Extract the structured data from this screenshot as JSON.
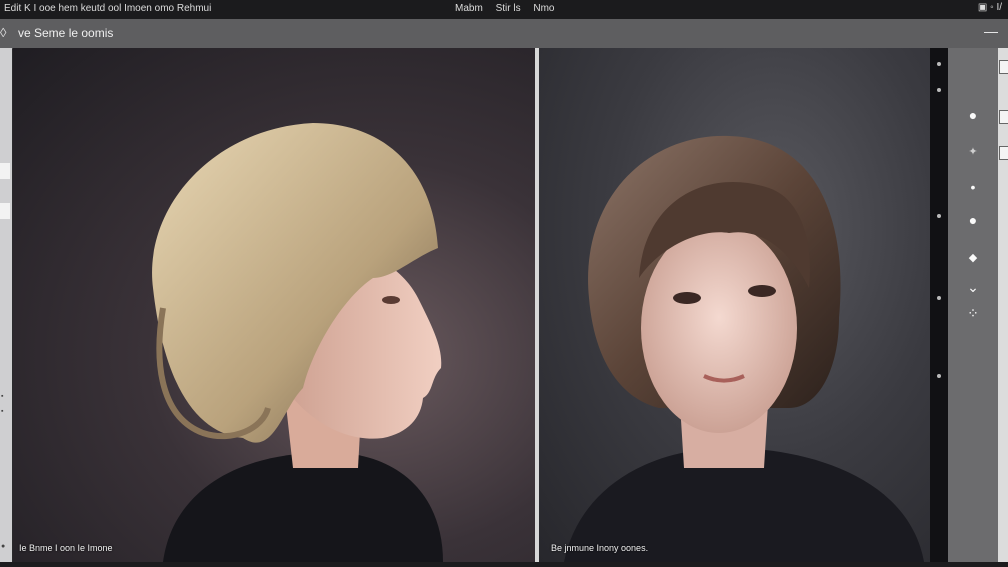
{
  "menubar": {
    "left_text": "Edit K  I  ooe  hem  keutd  ool  Imoen omo  Rehmui",
    "center_items": [
      "Mabm",
      "Stir  ls",
      "Nmo"
    ],
    "right_text": "▣  ◦  I/"
  },
  "toolbar": {
    "title": "ve  Seme  le  oomis",
    "lead_glyph": "◊",
    "minimize_glyph": "—"
  },
  "left_panel": {
    "caption": "Ie  Bnme  I  oon  Ie  Imone"
  },
  "right_panel": {
    "caption": "Be  jnmune  Inony  oones."
  },
  "colors": {
    "menubar_bg": "#1b1b1d",
    "toolbar_bg": "#5e5e60",
    "tool_column_bg": "#6c6c6e",
    "divider": "#d8d8d8"
  },
  "tools": [
    {
      "icon": "circle-tool-icon",
      "glyph": "●"
    },
    {
      "icon": "sparkle-tool-icon",
      "glyph": "✦"
    },
    {
      "icon": "dot-tool-icon",
      "glyph": "•"
    },
    {
      "icon": "fill-circle-tool-icon",
      "glyph": "●"
    },
    {
      "icon": "diamond-tool-icon",
      "glyph": "◆"
    },
    {
      "icon": "chevron-down-icon",
      "glyph": "⌄"
    },
    {
      "icon": "cluster-tool-icon",
      "glyph": "⁘"
    }
  ]
}
